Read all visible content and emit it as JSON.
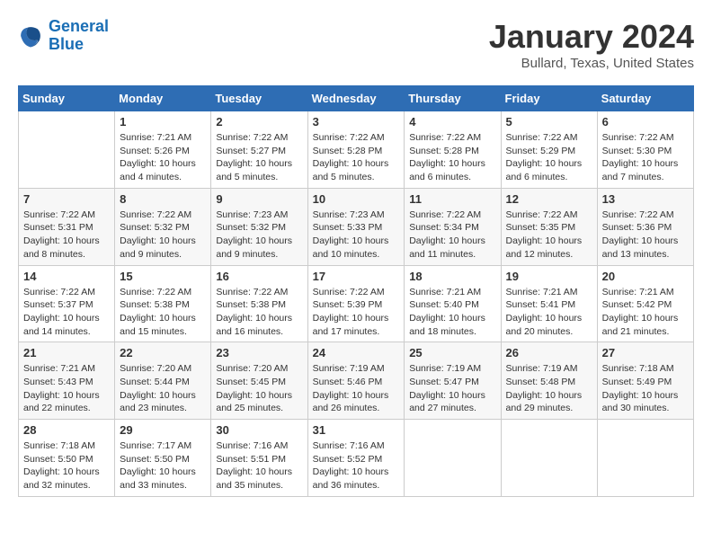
{
  "logo": {
    "line1": "General",
    "line2": "Blue"
  },
  "title": "January 2024",
  "subtitle": "Bullard, Texas, United States",
  "days_of_week": [
    "Sunday",
    "Monday",
    "Tuesday",
    "Wednesday",
    "Thursday",
    "Friday",
    "Saturday"
  ],
  "weeks": [
    [
      {
        "day": "",
        "info": ""
      },
      {
        "day": "1",
        "info": "Sunrise: 7:21 AM\nSunset: 5:26 PM\nDaylight: 10 hours\nand 4 minutes."
      },
      {
        "day": "2",
        "info": "Sunrise: 7:22 AM\nSunset: 5:27 PM\nDaylight: 10 hours\nand 5 minutes."
      },
      {
        "day": "3",
        "info": "Sunrise: 7:22 AM\nSunset: 5:28 PM\nDaylight: 10 hours\nand 5 minutes."
      },
      {
        "day": "4",
        "info": "Sunrise: 7:22 AM\nSunset: 5:28 PM\nDaylight: 10 hours\nand 6 minutes."
      },
      {
        "day": "5",
        "info": "Sunrise: 7:22 AM\nSunset: 5:29 PM\nDaylight: 10 hours\nand 6 minutes."
      },
      {
        "day": "6",
        "info": "Sunrise: 7:22 AM\nSunset: 5:30 PM\nDaylight: 10 hours\nand 7 minutes."
      }
    ],
    [
      {
        "day": "7",
        "info": "Sunrise: 7:22 AM\nSunset: 5:31 PM\nDaylight: 10 hours\nand 8 minutes."
      },
      {
        "day": "8",
        "info": "Sunrise: 7:22 AM\nSunset: 5:32 PM\nDaylight: 10 hours\nand 9 minutes."
      },
      {
        "day": "9",
        "info": "Sunrise: 7:23 AM\nSunset: 5:32 PM\nDaylight: 10 hours\nand 9 minutes."
      },
      {
        "day": "10",
        "info": "Sunrise: 7:23 AM\nSunset: 5:33 PM\nDaylight: 10 hours\nand 10 minutes."
      },
      {
        "day": "11",
        "info": "Sunrise: 7:22 AM\nSunset: 5:34 PM\nDaylight: 10 hours\nand 11 minutes."
      },
      {
        "day": "12",
        "info": "Sunrise: 7:22 AM\nSunset: 5:35 PM\nDaylight: 10 hours\nand 12 minutes."
      },
      {
        "day": "13",
        "info": "Sunrise: 7:22 AM\nSunset: 5:36 PM\nDaylight: 10 hours\nand 13 minutes."
      }
    ],
    [
      {
        "day": "14",
        "info": "Sunrise: 7:22 AM\nSunset: 5:37 PM\nDaylight: 10 hours\nand 14 minutes."
      },
      {
        "day": "15",
        "info": "Sunrise: 7:22 AM\nSunset: 5:38 PM\nDaylight: 10 hours\nand 15 minutes."
      },
      {
        "day": "16",
        "info": "Sunrise: 7:22 AM\nSunset: 5:38 PM\nDaylight: 10 hours\nand 16 minutes."
      },
      {
        "day": "17",
        "info": "Sunrise: 7:22 AM\nSunset: 5:39 PM\nDaylight: 10 hours\nand 17 minutes."
      },
      {
        "day": "18",
        "info": "Sunrise: 7:21 AM\nSunset: 5:40 PM\nDaylight: 10 hours\nand 18 minutes."
      },
      {
        "day": "19",
        "info": "Sunrise: 7:21 AM\nSunset: 5:41 PM\nDaylight: 10 hours\nand 20 minutes."
      },
      {
        "day": "20",
        "info": "Sunrise: 7:21 AM\nSunset: 5:42 PM\nDaylight: 10 hours\nand 21 minutes."
      }
    ],
    [
      {
        "day": "21",
        "info": "Sunrise: 7:21 AM\nSunset: 5:43 PM\nDaylight: 10 hours\nand 22 minutes."
      },
      {
        "day": "22",
        "info": "Sunrise: 7:20 AM\nSunset: 5:44 PM\nDaylight: 10 hours\nand 23 minutes."
      },
      {
        "day": "23",
        "info": "Sunrise: 7:20 AM\nSunset: 5:45 PM\nDaylight: 10 hours\nand 25 minutes."
      },
      {
        "day": "24",
        "info": "Sunrise: 7:19 AM\nSunset: 5:46 PM\nDaylight: 10 hours\nand 26 minutes."
      },
      {
        "day": "25",
        "info": "Sunrise: 7:19 AM\nSunset: 5:47 PM\nDaylight: 10 hours\nand 27 minutes."
      },
      {
        "day": "26",
        "info": "Sunrise: 7:19 AM\nSunset: 5:48 PM\nDaylight: 10 hours\nand 29 minutes."
      },
      {
        "day": "27",
        "info": "Sunrise: 7:18 AM\nSunset: 5:49 PM\nDaylight: 10 hours\nand 30 minutes."
      }
    ],
    [
      {
        "day": "28",
        "info": "Sunrise: 7:18 AM\nSunset: 5:50 PM\nDaylight: 10 hours\nand 32 minutes."
      },
      {
        "day": "29",
        "info": "Sunrise: 7:17 AM\nSunset: 5:50 PM\nDaylight: 10 hours\nand 33 minutes."
      },
      {
        "day": "30",
        "info": "Sunrise: 7:16 AM\nSunset: 5:51 PM\nDaylight: 10 hours\nand 35 minutes."
      },
      {
        "day": "31",
        "info": "Sunrise: 7:16 AM\nSunset: 5:52 PM\nDaylight: 10 hours\nand 36 minutes."
      },
      {
        "day": "",
        "info": ""
      },
      {
        "day": "",
        "info": ""
      },
      {
        "day": "",
        "info": ""
      }
    ]
  ]
}
